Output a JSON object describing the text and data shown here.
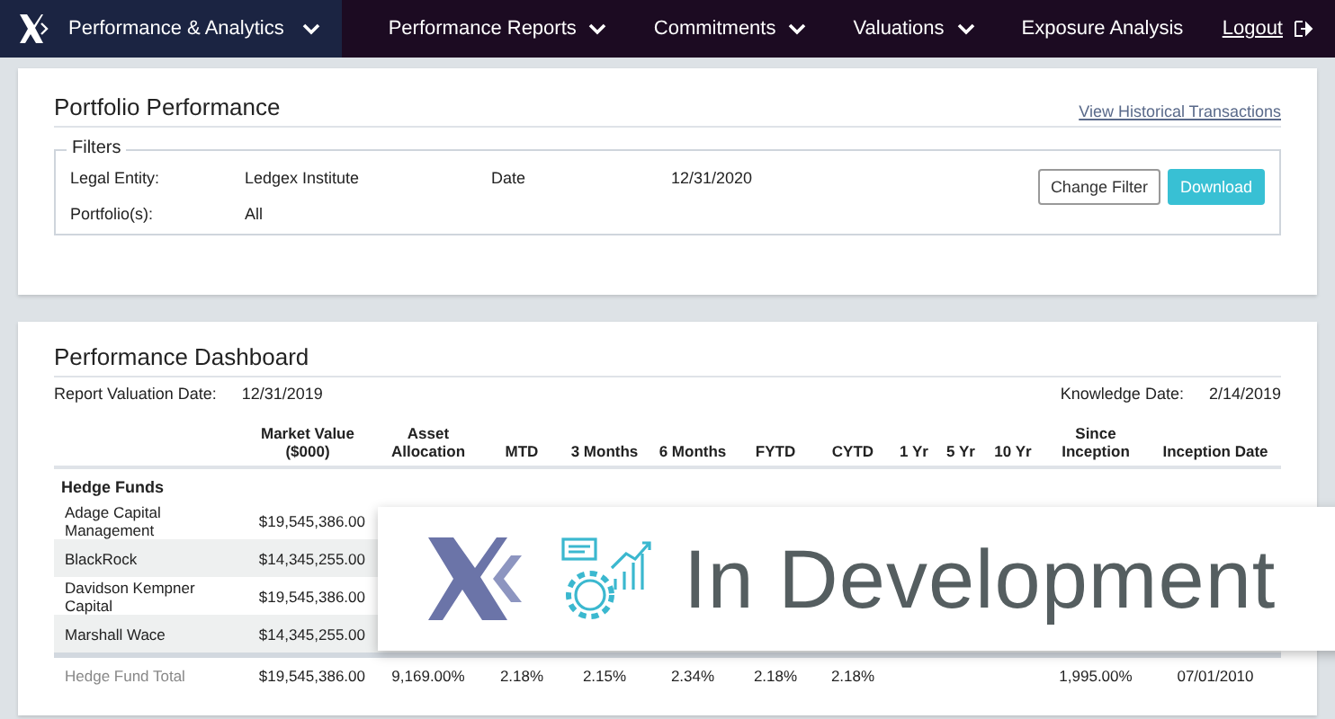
{
  "nav": {
    "brand_menu": "Performance & Analytics",
    "items": [
      {
        "label": "Performance Reports",
        "has_dropdown": true
      },
      {
        "label": "Commitments",
        "has_dropdown": true
      },
      {
        "label": "Valuations",
        "has_dropdown": true
      },
      {
        "label": "Exposure Analysis",
        "has_dropdown": false
      }
    ],
    "logout": "Logout"
  },
  "portfolio": {
    "title": "Portfolio Performance",
    "link": "View Historical Transactions",
    "filters": {
      "legend": "Filters",
      "fields": [
        {
          "label": "Legal Entity:",
          "value": "Ledgex Institute"
        },
        {
          "label": "Date",
          "value": "12/31/2020"
        },
        {
          "label": "Portfolio(s):",
          "value": "All"
        }
      ]
    },
    "buttons": [
      {
        "label": "Change Filter",
        "kind": "secondary"
      },
      {
        "label": "Download",
        "kind": "primary"
      }
    ]
  },
  "dashboard": {
    "title": "Performance Dashboard",
    "report_valuation_date": {
      "label": "Report Valuation Date:",
      "value": "12/31/2019"
    },
    "knowledge_date": {
      "label": "Knowledge Date:",
      "value": "2/14/2019"
    },
    "table": {
      "columns": [
        "Market Value ($000)",
        "Asset Allocation",
        "MTD",
        "3 Months",
        "6 Months",
        "FYTD",
        "CYTD",
        "1 Yr",
        "5 Yr",
        "10 Yr",
        "Since Inception",
        "Inception Date"
      ],
      "groups": [
        {
          "name": "Hedge Funds",
          "rows": [
            {
              "name": "Adage Capital Management",
              "market_value": "$19,545,386.00"
            },
            {
              "name": "BlackRock",
              "market_value": "$14,345,255.00"
            },
            {
              "name": "Davidson Kempner Capital",
              "market_value": "$19,545,386.00"
            },
            {
              "name": "Marshall Wace",
              "market_value": "$14,345,255.00"
            }
          ],
          "total": {
            "label": "Hedge Fund Total",
            "market_value": "$19,545,386.00",
            "asset_allocation": "9,169.00%",
            "mtd": "2.18%",
            "three_months": "2.15%",
            "six_months": "2.34%",
            "fytd": "2.18%",
            "cytd": "2.18%",
            "since_inception": "1,995.00%",
            "inception_date": "07/01/2010"
          }
        }
      ]
    }
  },
  "overlay": {
    "text": "In Development"
  }
}
